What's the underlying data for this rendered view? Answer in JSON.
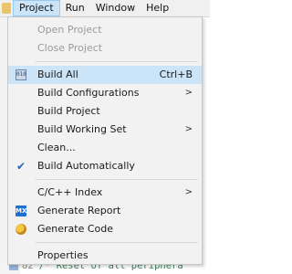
{
  "menubar": {
    "items": [
      {
        "label": "Project",
        "active": true
      },
      {
        "label": "Run",
        "active": false
      },
      {
        "label": "Window",
        "active": false
      },
      {
        "label": "Help",
        "active": false
      }
    ]
  },
  "menu": {
    "open_project": "Open Project",
    "close_project": "Close Project",
    "build_all": "Build All",
    "build_all_shortcut": "Ctrl+B",
    "build_configurations": "Build Configurations",
    "build_project": "Build Project",
    "build_working_set": "Build Working Set",
    "clean": "Clean...",
    "build_automatically": "Build Automatically",
    "cpp_index": "C/C++ Index",
    "generate_report": "Generate Report",
    "generate_code": "Generate Code",
    "properties": "Properties",
    "submenu_arrow": ">",
    "check_glyph": "✔",
    "mx_icon_text": "MX",
    "build_icon_text": "010"
  },
  "editor": {
    "line_number": "82",
    "code_text": "/* Reset of all periphera"
  },
  "colors": {
    "highlight": "#cce4f7",
    "menu_bg": "#f2f2f2",
    "disabled_text": "#9b9b9b"
  }
}
